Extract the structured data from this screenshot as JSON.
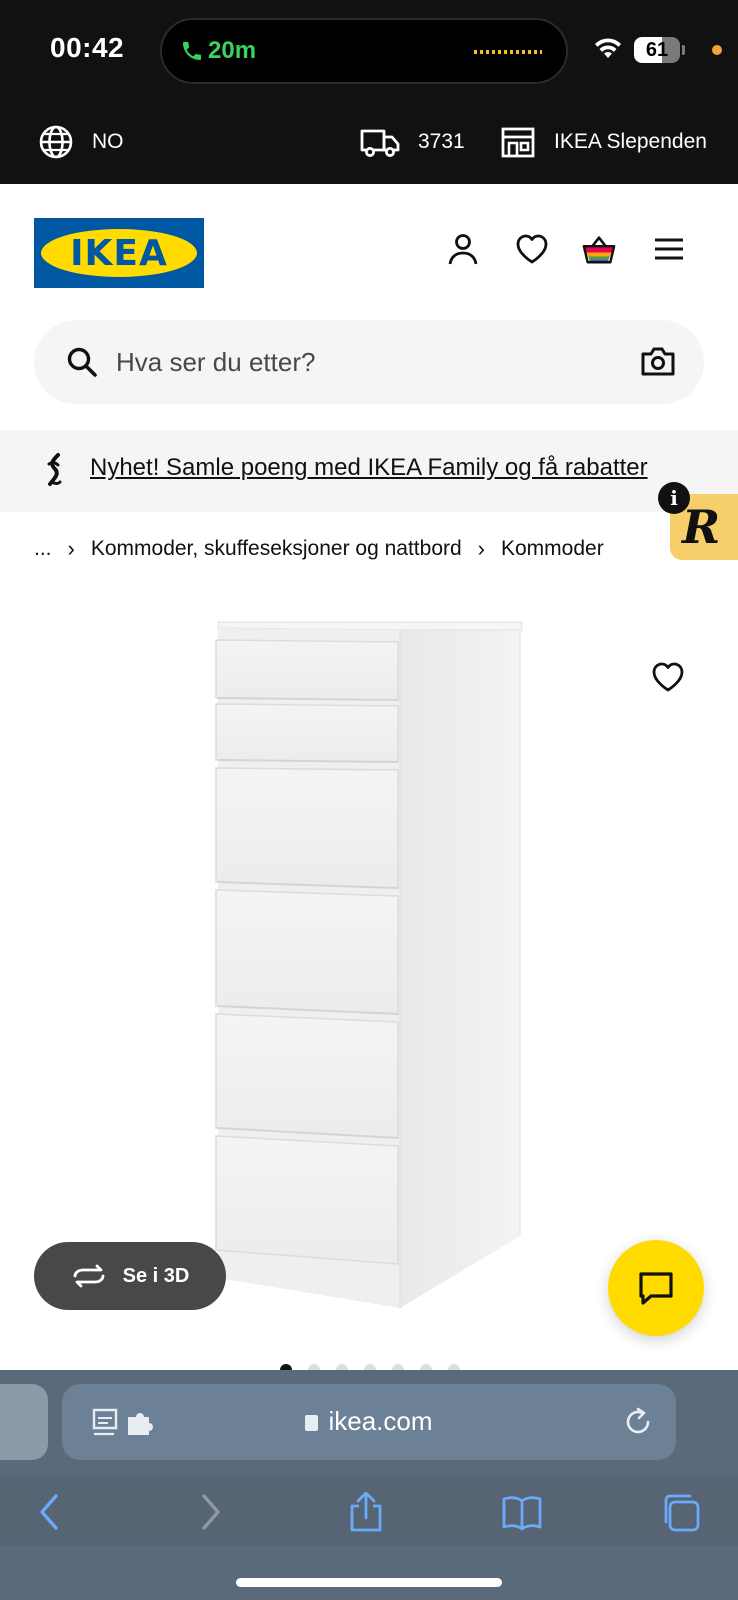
{
  "status": {
    "time": "00:42",
    "call_duration": "20m",
    "battery": "61"
  },
  "utility": {
    "language": "NO",
    "postcode": "3731",
    "store": "IKEA Slependen"
  },
  "header": {
    "logo": "IKEA"
  },
  "search": {
    "placeholder": "Hva ser du etter?"
  },
  "promo": {
    "text": "Nyhet! Samle poeng med IKEA Family og få rabatter"
  },
  "breadcrumb": {
    "ellipsis": "...",
    "parent": "Kommoder, skuffeseksjoner og nattbord",
    "current": "Kommoder"
  },
  "product": {
    "see_3d_label": "Se i 3D",
    "image_count": 7,
    "active_image": 1
  },
  "browser": {
    "url": "ikea.com"
  },
  "colors": {
    "ikea_blue": "#0058a3",
    "ikea_yellow": "#ffdb00",
    "call_green": "#3ad45c"
  }
}
